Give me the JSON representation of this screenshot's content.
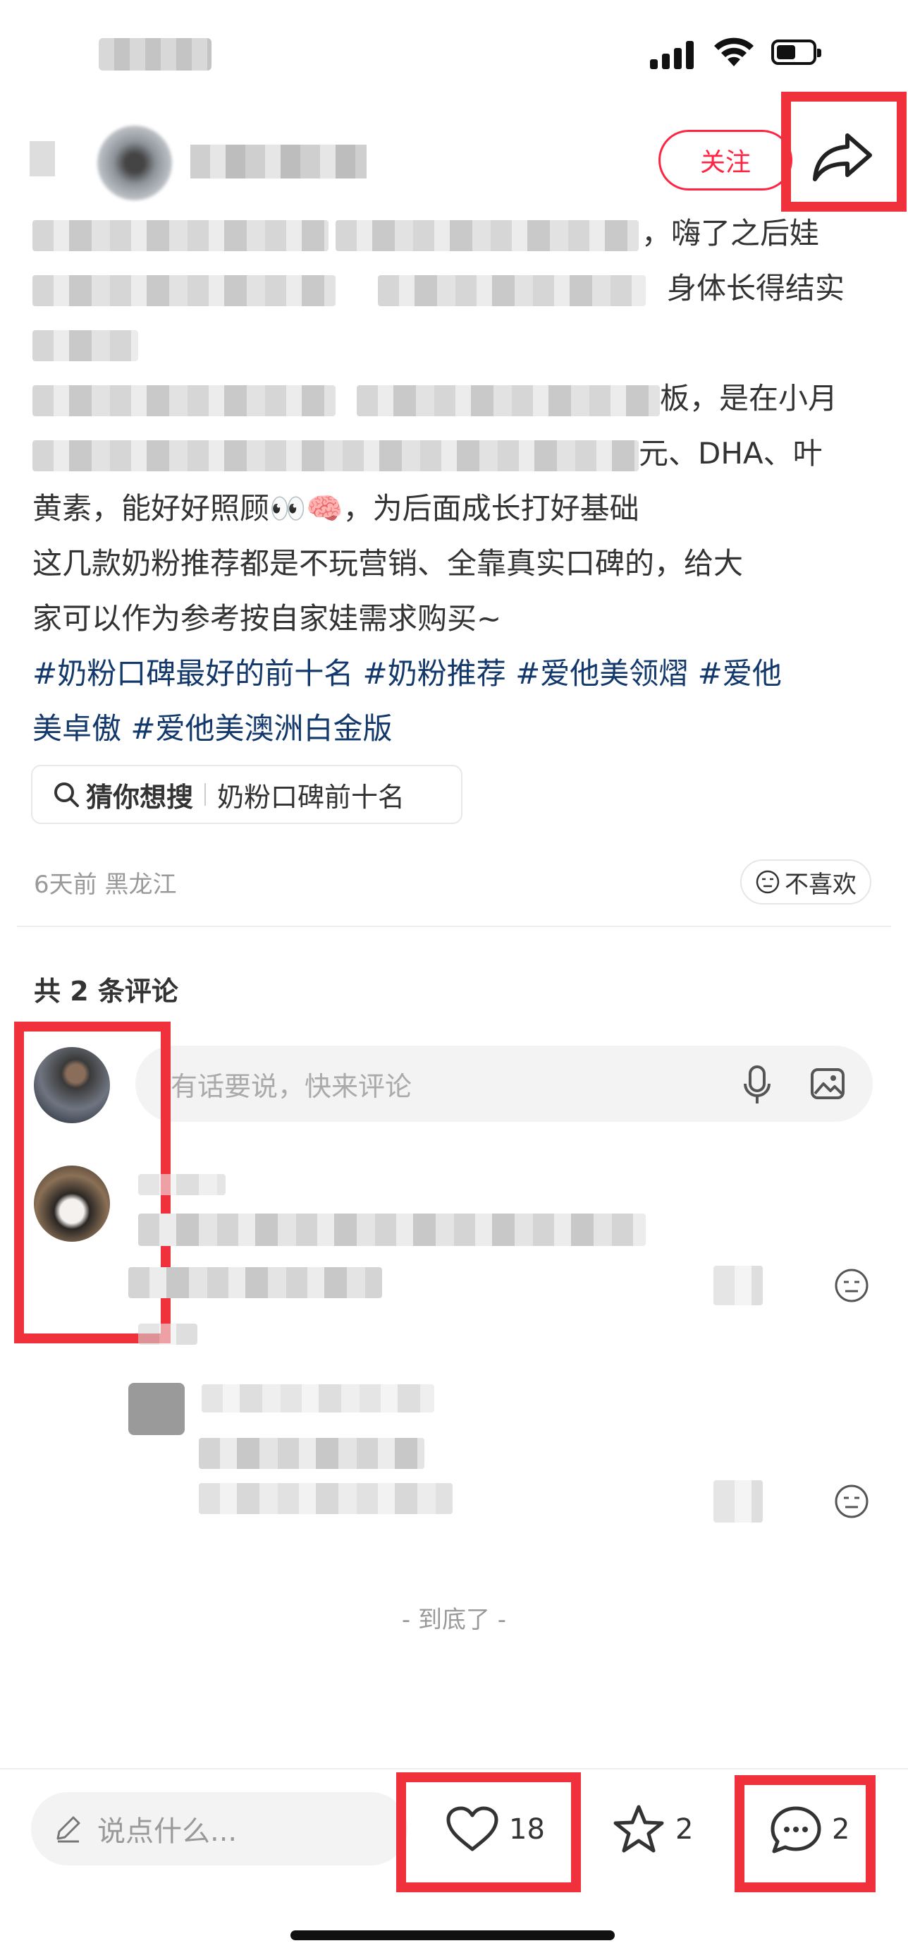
{
  "status_bar": {
    "battery_level": 0.55
  },
  "header": {
    "follow_label": "关注"
  },
  "post": {
    "line1_visible": "，嗨了之后娃",
    "line2_visible": "身体长得结实",
    "line4_visible": "板，是在小月",
    "line5_visible": "元、DHA、叶",
    "line6": "黄素，能好好照顾",
    "line6_emoji": "👀🧠",
    "line6_end": "，为后面成长打好基础",
    "line7": "这几款奶粉推荐都是不玩营销、全靠真实口碑的，给大",
    "line8": "家可以作为参考按自家娃需求购买~",
    "tags_line1": "#奶粉口碑最好的前十名 #奶粉推荐 #爱他美领熠 #爱他",
    "tags_line2": "美卓傲 #爱他美澳洲白金版"
  },
  "suggest": {
    "label": "猜你想搜",
    "query": "奶粉口碑前十名"
  },
  "meta": {
    "date_location": "6天前 黑龙江",
    "dislike_label": "不喜欢"
  },
  "comments": {
    "count_label": "共 2 条评论",
    "input_placeholder": "有话要说，快来评论"
  },
  "end_label": "- 到底了 -",
  "bottom_bar": {
    "say_placeholder": "说点什么...",
    "like_count": "18",
    "star_count": "2",
    "comment_count": "2"
  },
  "colors": {
    "accent": "#ff2442",
    "highlight_box": "#f0303a",
    "tag": "#13386c"
  }
}
